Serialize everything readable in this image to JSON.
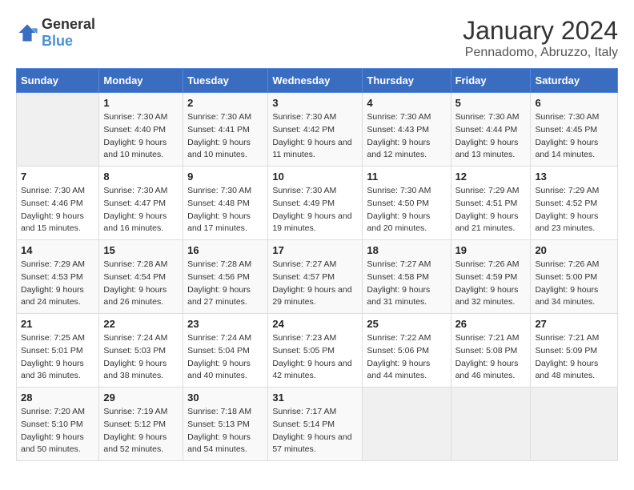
{
  "header": {
    "logo_general": "General",
    "logo_blue": "Blue",
    "title": "January 2024",
    "subtitle": "Pennadomo, Abruzzo, Italy"
  },
  "weekdays": [
    "Sunday",
    "Monday",
    "Tuesday",
    "Wednesday",
    "Thursday",
    "Friday",
    "Saturday"
  ],
  "weeks": [
    [
      {
        "day": "",
        "sunrise": "",
        "sunset": "",
        "daylight": ""
      },
      {
        "day": "1",
        "sunrise": "Sunrise: 7:30 AM",
        "sunset": "Sunset: 4:40 PM",
        "daylight": "Daylight: 9 hours and 10 minutes."
      },
      {
        "day": "2",
        "sunrise": "Sunrise: 7:30 AM",
        "sunset": "Sunset: 4:41 PM",
        "daylight": "Daylight: 9 hours and 10 minutes."
      },
      {
        "day": "3",
        "sunrise": "Sunrise: 7:30 AM",
        "sunset": "Sunset: 4:42 PM",
        "daylight": "Daylight: 9 hours and 11 minutes."
      },
      {
        "day": "4",
        "sunrise": "Sunrise: 7:30 AM",
        "sunset": "Sunset: 4:43 PM",
        "daylight": "Daylight: 9 hours and 12 minutes."
      },
      {
        "day": "5",
        "sunrise": "Sunrise: 7:30 AM",
        "sunset": "Sunset: 4:44 PM",
        "daylight": "Daylight: 9 hours and 13 minutes."
      },
      {
        "day": "6",
        "sunrise": "Sunrise: 7:30 AM",
        "sunset": "Sunset: 4:45 PM",
        "daylight": "Daylight: 9 hours and 14 minutes."
      }
    ],
    [
      {
        "day": "7",
        "sunrise": "Sunrise: 7:30 AM",
        "sunset": "Sunset: 4:46 PM",
        "daylight": "Daylight: 9 hours and 15 minutes."
      },
      {
        "day": "8",
        "sunrise": "Sunrise: 7:30 AM",
        "sunset": "Sunset: 4:47 PM",
        "daylight": "Daylight: 9 hours and 16 minutes."
      },
      {
        "day": "9",
        "sunrise": "Sunrise: 7:30 AM",
        "sunset": "Sunset: 4:48 PM",
        "daylight": "Daylight: 9 hours and 17 minutes."
      },
      {
        "day": "10",
        "sunrise": "Sunrise: 7:30 AM",
        "sunset": "Sunset: 4:49 PM",
        "daylight": "Daylight: 9 hours and 19 minutes."
      },
      {
        "day": "11",
        "sunrise": "Sunrise: 7:30 AM",
        "sunset": "Sunset: 4:50 PM",
        "daylight": "Daylight: 9 hours and 20 minutes."
      },
      {
        "day": "12",
        "sunrise": "Sunrise: 7:29 AM",
        "sunset": "Sunset: 4:51 PM",
        "daylight": "Daylight: 9 hours and 21 minutes."
      },
      {
        "day": "13",
        "sunrise": "Sunrise: 7:29 AM",
        "sunset": "Sunset: 4:52 PM",
        "daylight": "Daylight: 9 hours and 23 minutes."
      }
    ],
    [
      {
        "day": "14",
        "sunrise": "Sunrise: 7:29 AM",
        "sunset": "Sunset: 4:53 PM",
        "daylight": "Daylight: 9 hours and 24 minutes."
      },
      {
        "day": "15",
        "sunrise": "Sunrise: 7:28 AM",
        "sunset": "Sunset: 4:54 PM",
        "daylight": "Daylight: 9 hours and 26 minutes."
      },
      {
        "day": "16",
        "sunrise": "Sunrise: 7:28 AM",
        "sunset": "Sunset: 4:56 PM",
        "daylight": "Daylight: 9 hours and 27 minutes."
      },
      {
        "day": "17",
        "sunrise": "Sunrise: 7:27 AM",
        "sunset": "Sunset: 4:57 PM",
        "daylight": "Daylight: 9 hours and 29 minutes."
      },
      {
        "day": "18",
        "sunrise": "Sunrise: 7:27 AM",
        "sunset": "Sunset: 4:58 PM",
        "daylight": "Daylight: 9 hours and 31 minutes."
      },
      {
        "day": "19",
        "sunrise": "Sunrise: 7:26 AM",
        "sunset": "Sunset: 4:59 PM",
        "daylight": "Daylight: 9 hours and 32 minutes."
      },
      {
        "day": "20",
        "sunrise": "Sunrise: 7:26 AM",
        "sunset": "Sunset: 5:00 PM",
        "daylight": "Daylight: 9 hours and 34 minutes."
      }
    ],
    [
      {
        "day": "21",
        "sunrise": "Sunrise: 7:25 AM",
        "sunset": "Sunset: 5:01 PM",
        "daylight": "Daylight: 9 hours and 36 minutes."
      },
      {
        "day": "22",
        "sunrise": "Sunrise: 7:24 AM",
        "sunset": "Sunset: 5:03 PM",
        "daylight": "Daylight: 9 hours and 38 minutes."
      },
      {
        "day": "23",
        "sunrise": "Sunrise: 7:24 AM",
        "sunset": "Sunset: 5:04 PM",
        "daylight": "Daylight: 9 hours and 40 minutes."
      },
      {
        "day": "24",
        "sunrise": "Sunrise: 7:23 AM",
        "sunset": "Sunset: 5:05 PM",
        "daylight": "Daylight: 9 hours and 42 minutes."
      },
      {
        "day": "25",
        "sunrise": "Sunrise: 7:22 AM",
        "sunset": "Sunset: 5:06 PM",
        "daylight": "Daylight: 9 hours and 44 minutes."
      },
      {
        "day": "26",
        "sunrise": "Sunrise: 7:21 AM",
        "sunset": "Sunset: 5:08 PM",
        "daylight": "Daylight: 9 hours and 46 minutes."
      },
      {
        "day": "27",
        "sunrise": "Sunrise: 7:21 AM",
        "sunset": "Sunset: 5:09 PM",
        "daylight": "Daylight: 9 hours and 48 minutes."
      }
    ],
    [
      {
        "day": "28",
        "sunrise": "Sunrise: 7:20 AM",
        "sunset": "Sunset: 5:10 PM",
        "daylight": "Daylight: 9 hours and 50 minutes."
      },
      {
        "day": "29",
        "sunrise": "Sunrise: 7:19 AM",
        "sunset": "Sunset: 5:12 PM",
        "daylight": "Daylight: 9 hours and 52 minutes."
      },
      {
        "day": "30",
        "sunrise": "Sunrise: 7:18 AM",
        "sunset": "Sunset: 5:13 PM",
        "daylight": "Daylight: 9 hours and 54 minutes."
      },
      {
        "day": "31",
        "sunrise": "Sunrise: 7:17 AM",
        "sunset": "Sunset: 5:14 PM",
        "daylight": "Daylight: 9 hours and 57 minutes."
      },
      {
        "day": "",
        "sunrise": "",
        "sunset": "",
        "daylight": ""
      },
      {
        "day": "",
        "sunrise": "",
        "sunset": "",
        "daylight": ""
      },
      {
        "day": "",
        "sunrise": "",
        "sunset": "",
        "daylight": ""
      }
    ]
  ]
}
